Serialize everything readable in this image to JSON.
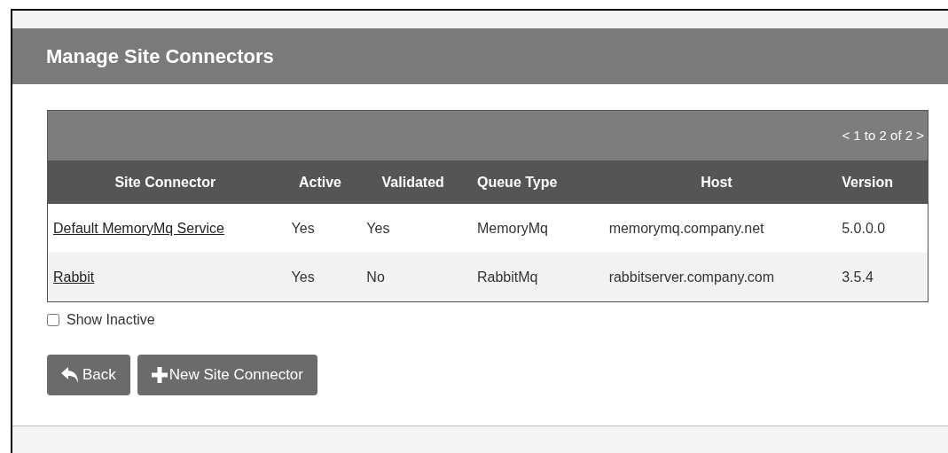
{
  "page": {
    "title": "Manage Site Connectors"
  },
  "table": {
    "pager": "< 1 to 2 of 2 >",
    "columns": [
      "Site Connector",
      "Active",
      "Validated",
      "Queue Type",
      "Host",
      "Version"
    ],
    "rows": [
      {
        "site_connector": "Default MemoryMq Service",
        "active": "Yes",
        "validated": "Yes",
        "queue_type": "MemoryMq",
        "host": "memorymq.company.net",
        "version": "5.0.0.0"
      },
      {
        "site_connector": "Rabbit",
        "active": "Yes",
        "validated": "No",
        "queue_type": "RabbitMq",
        "host": "rabbitserver.company.com",
        "version": "3.5.4"
      }
    ]
  },
  "show_inactive": {
    "label": "Show Inactive",
    "checked": false
  },
  "buttons": [
    {
      "label": "Back",
      "kind": "back"
    },
    {
      "label": "New Site Connector",
      "kind": "add"
    }
  ]
}
